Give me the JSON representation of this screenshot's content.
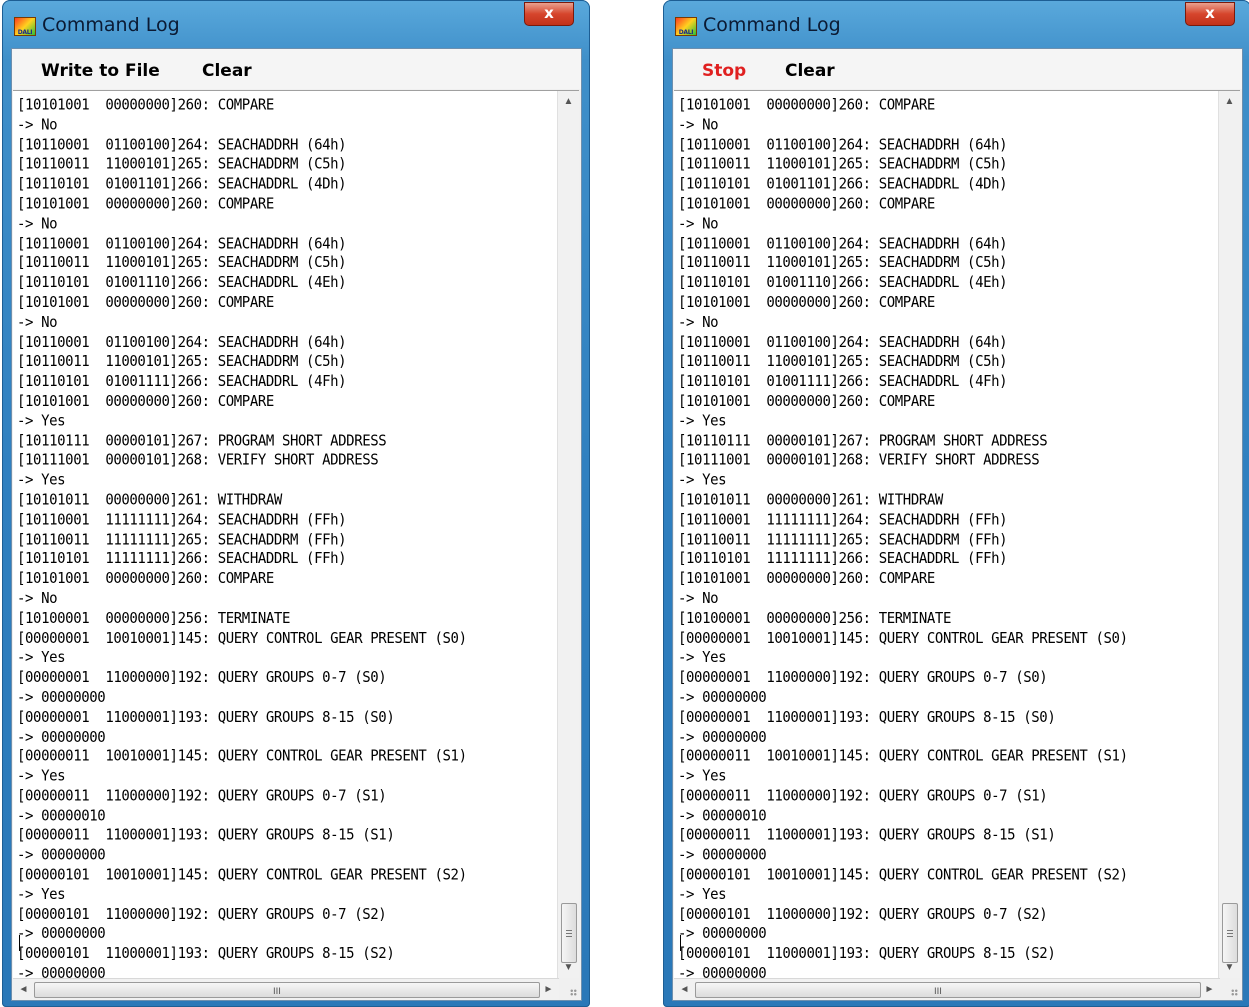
{
  "windows": [
    {
      "title": "Command Log",
      "close_label": "x",
      "icon_label": "DALI",
      "menu": [
        "Write to File",
        "Clear"
      ]
    },
    {
      "title": "Command Log",
      "close_label": "x",
      "icon_label": "DALI",
      "menu": [
        "Stop",
        "Clear"
      ]
    }
  ],
  "accent_colors": {
    "stop_label": "#e02020",
    "title_bar": "#3f8fc9",
    "close_button": "#d6452c"
  },
  "log_lines": [
    "[10101001  00000000]260: COMPARE",
    "-> No",
    "[10110001  01100100]264: SEACHADDRH (64h)",
    "[10110011  11000101]265: SEACHADDRM (C5h)",
    "[10110101  01001101]266: SEACHADDRL (4Dh)",
    "[10101001  00000000]260: COMPARE",
    "-> No",
    "[10110001  01100100]264: SEACHADDRH (64h)",
    "[10110011  11000101]265: SEACHADDRM (C5h)",
    "[10110101  01001110]266: SEACHADDRL (4Eh)",
    "[10101001  00000000]260: COMPARE",
    "-> No",
    "[10110001  01100100]264: SEACHADDRH (64h)",
    "[10110011  11000101]265: SEACHADDRM (C5h)",
    "[10110101  01001111]266: SEACHADDRL (4Fh)",
    "[10101001  00000000]260: COMPARE",
    "-> Yes",
    "[10110111  00000101]267: PROGRAM SHORT ADDRESS",
    "[10111001  00000101]268: VERIFY SHORT ADDRESS",
    "-> Yes",
    "[10101011  00000000]261: WITHDRAW",
    "[10110001  11111111]264: SEACHADDRH (FFh)",
    "[10110011  11111111]265: SEACHADDRM (FFh)",
    "[10110101  11111111]266: SEACHADDRL (FFh)",
    "[10101001  00000000]260: COMPARE",
    "-> No",
    "[10100001  00000000]256: TERMINATE",
    "[00000001  10010001]145: QUERY CONTROL GEAR PRESENT (S0)",
    "-> Yes",
    "[00000001  11000000]192: QUERY GROUPS 0-7 (S0)",
    "-> 00000000",
    "[00000001  11000001]193: QUERY GROUPS 8-15 (S0)",
    "-> 00000000",
    "[00000011  10010001]145: QUERY CONTROL GEAR PRESENT (S1)",
    "-> Yes",
    "[00000011  11000000]192: QUERY GROUPS 0-7 (S1)",
    "-> 00000010",
    "[00000011  11000001]193: QUERY GROUPS 8-15 (S1)",
    "-> 00000000",
    "[00000101  10010001]145: QUERY CONTROL GEAR PRESENT (S2)",
    "-> Yes",
    "[00000101  11000000]192: QUERY GROUPS 0-7 (S2)",
    "-> 00000000",
    "[00000101  11000001]193: QUERY GROUPS 8-15 (S2)",
    "-> 00000000"
  ],
  "scrollbars": {
    "up_arrow": "▲",
    "down_arrow": "▼",
    "left_arrow": "◄",
    "right_arrow": "►",
    "hgrip": "III",
    "vgrip": "≡"
  }
}
